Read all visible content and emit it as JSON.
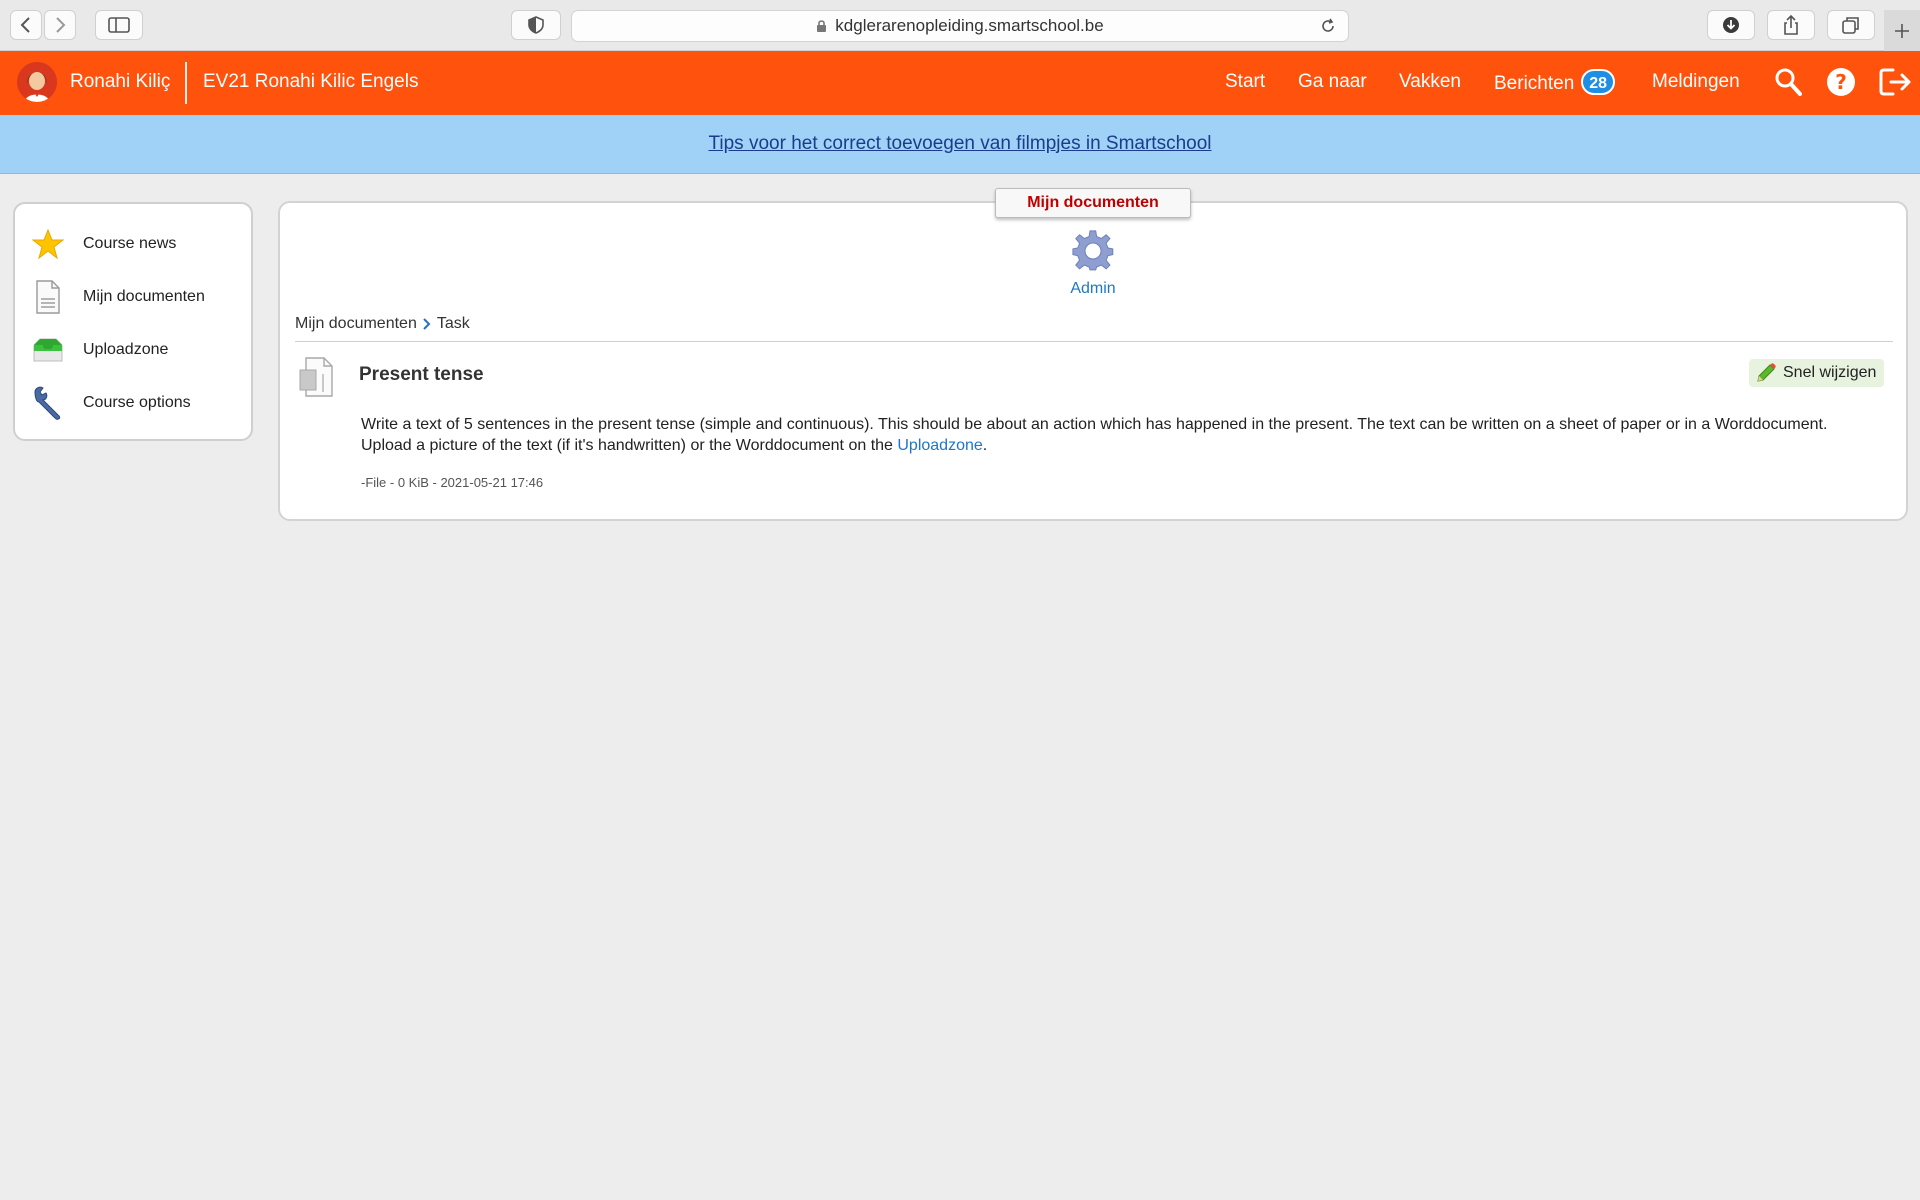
{
  "browser": {
    "url": "kdglerarenopleiding.smartschool.be",
    "icons": [
      "back-icon",
      "forward-icon",
      "sidebar-icon",
      "shield-icon",
      "lock-icon",
      "reload-icon",
      "download-icon",
      "share-icon",
      "tabs-icon",
      "new-tab-icon"
    ]
  },
  "header": {
    "user_name": "Ronahi Kiliç",
    "course_name": "EV21 Ronahi Kilic Engels",
    "nav": {
      "start": "Start",
      "ga_naar": "Ga naar",
      "vakken": "Vakken",
      "berichten": "Berichten",
      "berichten_count": "28",
      "meldingen": "Meldingen"
    },
    "bg_color": "#ff520d"
  },
  "banner": {
    "link_text": "Tips voor het correct toevoegen van filmpjes in Smartschool",
    "bg_color": "#9fd2f6"
  },
  "sidebar": {
    "items": [
      {
        "label": "Course news",
        "icon": "star-icon"
      },
      {
        "label": "Mijn documenten",
        "icon": "document-icon"
      },
      {
        "label": "Uploadzone",
        "icon": "inbox-tray-icon"
      },
      {
        "label": "Course options",
        "icon": "wrench-icon"
      }
    ]
  },
  "main": {
    "section_label": "Mijn documenten",
    "admin_label": "Admin",
    "breadcrumb": [
      "Mijn documenten",
      "Task"
    ],
    "document": {
      "title": "Present tense",
      "quick_edit_label": "Snel wijzigen",
      "description_1": "Write a text of 5 sentences in the present tense (simple and continuous). This should be about an action which has happened in the present. The text can be written on a sheet of paper or in a Worddocument. Upload a picture of the text (if it's handwritten) or the Worddocument on the ",
      "description_link": "Uploadzone",
      "description_end": ".",
      "meta": "-File - 0 KiB - 2021-05-21 17:46"
    }
  }
}
